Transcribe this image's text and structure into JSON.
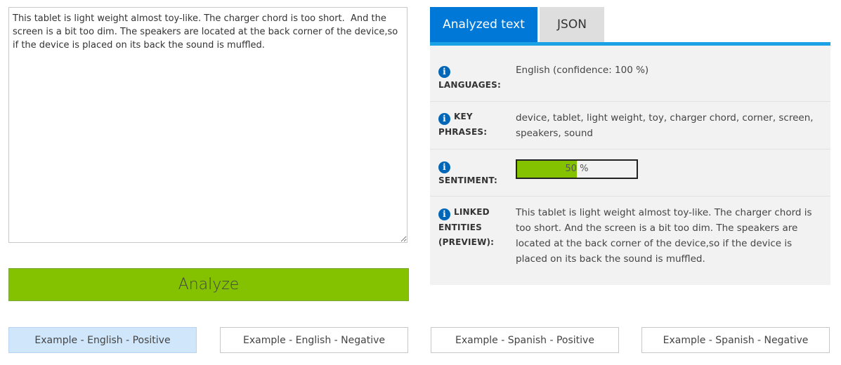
{
  "input": {
    "text": "This tablet is light weight almost toy-like. The charger chord is too short.  And the screen is a bit too dim. The speakers are located at the back corner of the device,so if the device is placed on its back the sound is muffled."
  },
  "analyze_label": "Analyze",
  "tabs": [
    {
      "label": "Analyzed text",
      "active": true
    },
    {
      "label": "JSON",
      "active": false
    }
  ],
  "results": {
    "languages": {
      "label_line1": "LANGUAGES:",
      "value": "English (confidence: 100 %)"
    },
    "key_phrases": {
      "label_line1": "KEY",
      "label_line2": "PHRASES:",
      "value": "device, tablet, light weight, toy, charger chord, corner, screen, speakers, sound"
    },
    "sentiment": {
      "label_line1": "SENTIMENT:",
      "percent": 50,
      "percent_text": "50 %"
    },
    "linked_entities": {
      "label_line1": "LINKED",
      "label_line2": "ENTITIES",
      "label_line3": "(PREVIEW):",
      "value": "This tablet is light weight almost toy-like. The charger chord is too short. And the screen is a bit too dim. The speakers are located at the back corner of the device,so if the device is placed on its back the sound is muffled."
    }
  },
  "examples": [
    {
      "label": "Example - English - Positive",
      "selected": true
    },
    {
      "label": "Example - English - Negative",
      "selected": false
    },
    {
      "label": "Example - Spanish - Positive",
      "selected": false
    },
    {
      "label": "Example - Spanish - Negative",
      "selected": false
    }
  ],
  "info_icon_glyph": "i",
  "colors": {
    "accent_blue": "#0078d7",
    "tab_bar": "#1aa1e6",
    "analyze_green": "#84c200",
    "selected_example": "#cfe6fb"
  }
}
